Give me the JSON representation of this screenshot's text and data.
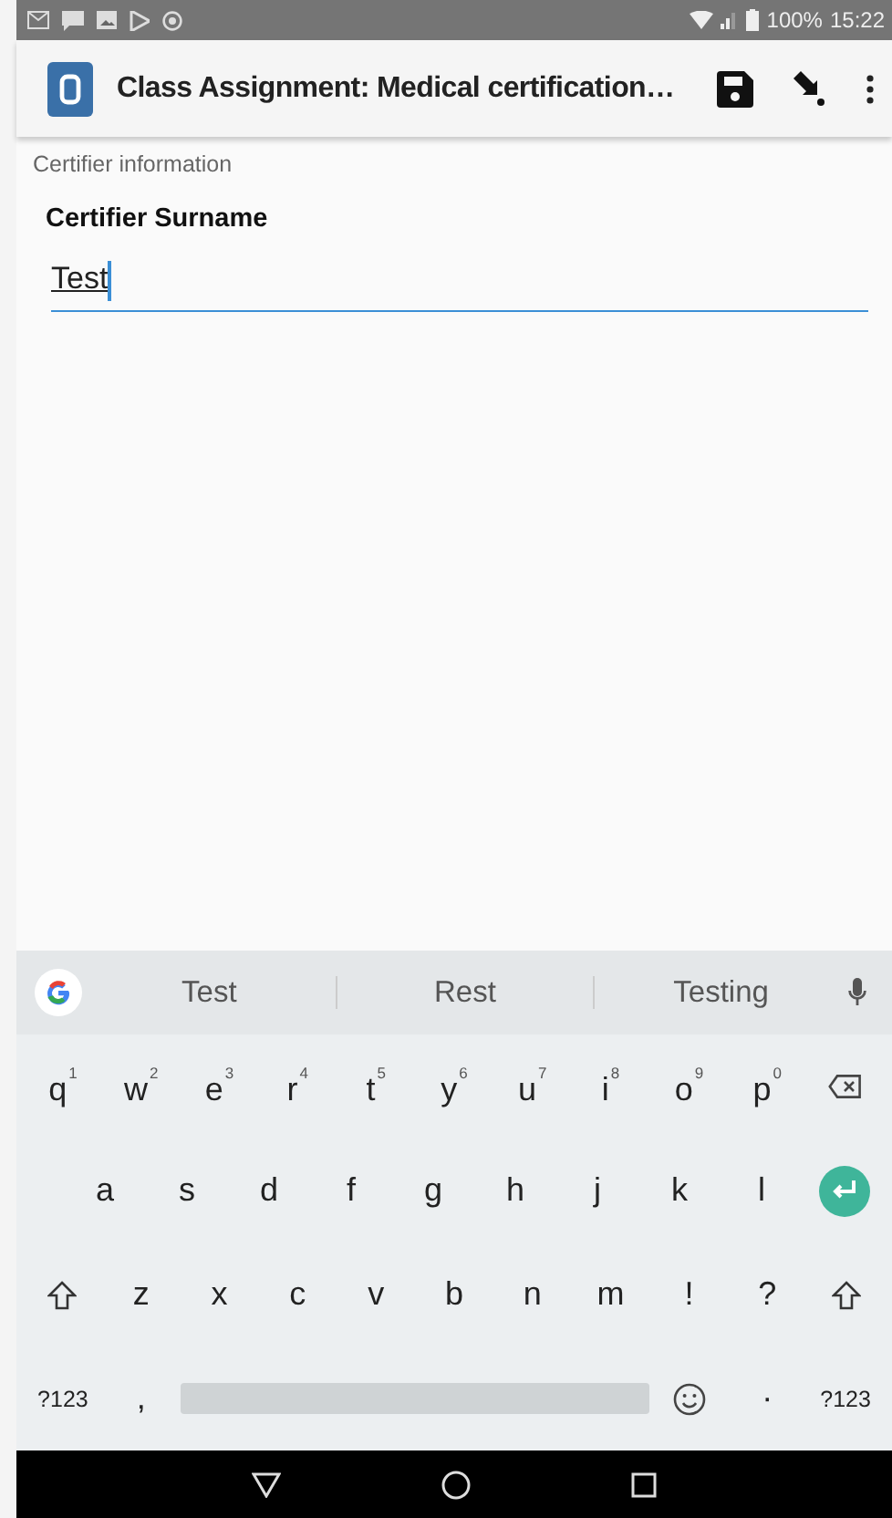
{
  "status_bar": {
    "battery": "100%",
    "time": "15:22"
  },
  "toolbar": {
    "title": "Class Assignment: Medical certification…"
  },
  "form": {
    "section": "Certifier information",
    "field": {
      "label": "Certifier Surname",
      "value": "Test"
    }
  },
  "keyboard": {
    "suggestions": [
      "Test",
      "Rest",
      "Testing"
    ],
    "key_rows": [
      {
        "keys": [
          {
            "kind": "letter",
            "label": "q",
            "hint": "1"
          },
          {
            "kind": "letter",
            "label": "w",
            "hint": "2"
          },
          {
            "kind": "letter",
            "label": "e",
            "hint": "3"
          },
          {
            "kind": "letter",
            "label": "r",
            "hint": "4"
          },
          {
            "kind": "letter",
            "label": "t",
            "hint": "5"
          },
          {
            "kind": "letter",
            "label": "y",
            "hint": "6"
          },
          {
            "kind": "letter",
            "label": "u",
            "hint": "7"
          },
          {
            "kind": "letter",
            "label": "i",
            "hint": "8"
          },
          {
            "kind": "letter",
            "label": "o",
            "hint": "9"
          },
          {
            "kind": "letter",
            "label": "p",
            "hint": "0"
          },
          {
            "kind": "backspace"
          }
        ]
      },
      {
        "keys": [
          {
            "kind": "letter",
            "label": "a"
          },
          {
            "kind": "letter",
            "label": "s"
          },
          {
            "kind": "letter",
            "label": "d"
          },
          {
            "kind": "letter",
            "label": "f"
          },
          {
            "kind": "letter",
            "label": "g"
          },
          {
            "kind": "letter",
            "label": "h"
          },
          {
            "kind": "letter",
            "label": "j"
          },
          {
            "kind": "letter",
            "label": "k"
          },
          {
            "kind": "letter",
            "label": "l"
          },
          {
            "kind": "enter"
          }
        ]
      },
      {
        "keys": [
          {
            "kind": "shift"
          },
          {
            "kind": "letter",
            "label": "z"
          },
          {
            "kind": "letter",
            "label": "x"
          },
          {
            "kind": "letter",
            "label": "c"
          },
          {
            "kind": "letter",
            "label": "v"
          },
          {
            "kind": "letter",
            "label": "b"
          },
          {
            "kind": "letter",
            "label": "n"
          },
          {
            "kind": "letter",
            "label": "m"
          },
          {
            "kind": "letter",
            "label": "!"
          },
          {
            "kind": "letter",
            "label": "?"
          },
          {
            "kind": "shift"
          }
        ]
      },
      {
        "keys": [
          {
            "kind": "small",
            "label": "?123"
          },
          {
            "kind": "letter",
            "label": ","
          },
          {
            "kind": "space"
          },
          {
            "kind": "emoji"
          },
          {
            "kind": "letter",
            "label": "·"
          },
          {
            "kind": "small",
            "label": "?123"
          }
        ]
      }
    ]
  }
}
